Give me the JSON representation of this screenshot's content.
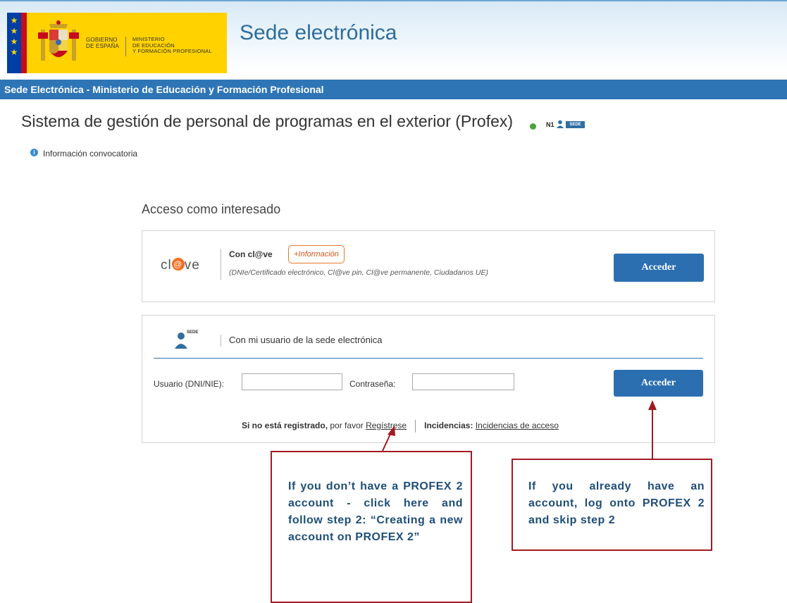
{
  "header": {
    "gobierno": "GOBIERNO\nDE ESPAÑA",
    "ministerio": "MINISTERIO\nDE EDUCACIÓN\nY FORMACIÓN PROFESIONAL",
    "site_title": "Sede electrónica"
  },
  "nav": {
    "bar_text": "Sede Electrónica - Ministerio de Educación y Formación Profesional"
  },
  "app": {
    "title": "Sistema de gestión de personal de programas en el exterior (Profex)",
    "level": "N1",
    "badge": "SEDE",
    "info_link": "Información convocatoria"
  },
  "access": {
    "title": "Acceso como interesado",
    "clave": {
      "logo_prefix": "cl",
      "logo_at": "@",
      "logo_suffix": "ve",
      "label": "Con cl@ve",
      "more_info": "+Información",
      "subtitle": "(DNIe/Certificado electrónico, Cl@ve pin, Cl@ve permanente, Ciudadanos UE)",
      "button": "Acceder"
    },
    "sede": {
      "badge": "SEDE",
      "label": "Con mi usuario de la sede electrónica",
      "user_label": "Usuario (DNI/NIE):",
      "user_value": "",
      "password_label": "Contraseña:",
      "password_value": "",
      "button": "Acceder",
      "not_registered": "Si no está registrado,",
      "please": " por favor ",
      "register_link": "Regístrese",
      "incidents_label": "Incidencias:",
      "incidents_link": "Incidencias de acceso"
    }
  },
  "callouts": {
    "left": "If you don’t have a PROFEX 2 account - click here and follow step 2: “Creating a new account on PROFEX 2”",
    "right": "If you already have an account, log onto PROFEX 2 and skip step 2"
  },
  "colors": {
    "brand_yellow": "#ffd200",
    "nav_blue": "#2e75b6",
    "button_blue": "#2b6fb1",
    "clave_orange": "#f26f21",
    "callout_border": "#a31a22",
    "callout_text": "#1f4e79"
  }
}
